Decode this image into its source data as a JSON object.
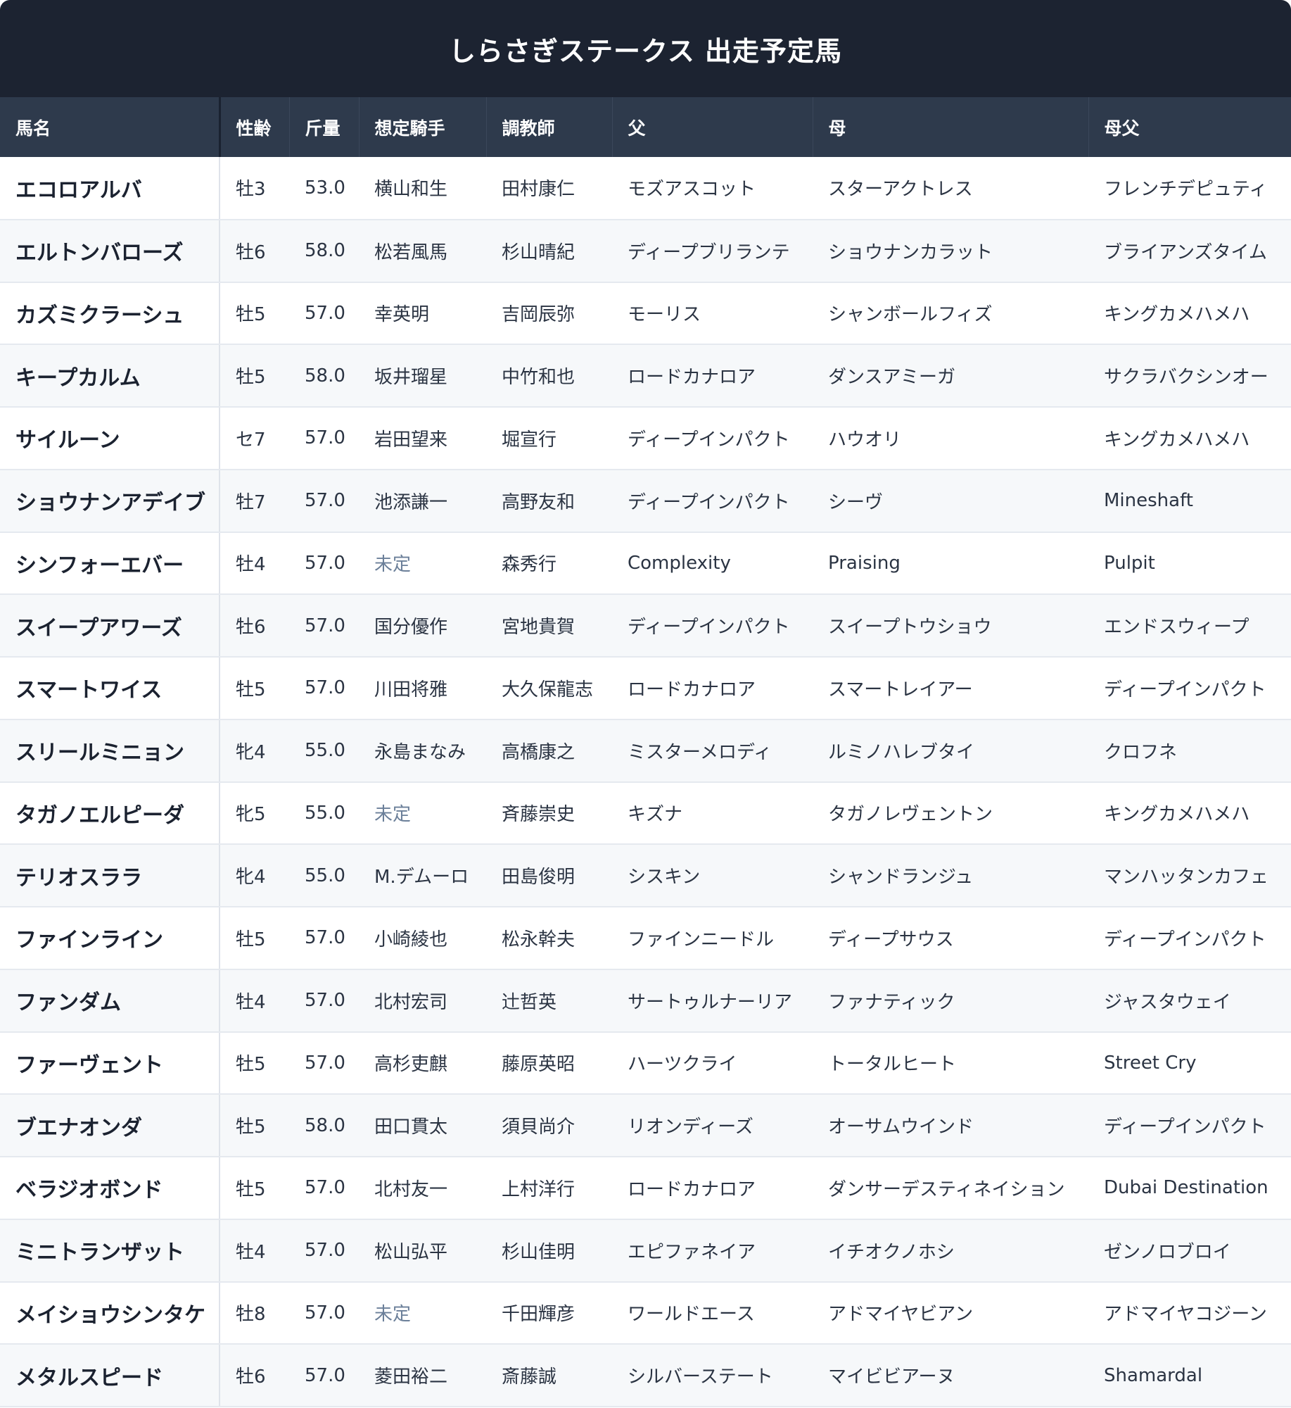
{
  "title": "しらさぎステークス 出走予定馬",
  "headers": [
    "馬名",
    "性齢",
    "斤量",
    "想定騎手",
    "調教師",
    "父",
    "母",
    "母父"
  ],
  "undecided_color": "#6b7f99",
  "rows": [
    {
      "name": "エコロアルバ",
      "sex_age": "牡3",
      "weight": "53.0",
      "jockey": "横山和生",
      "trainer": "田村康仁",
      "sire": "モズアスコット",
      "dam": "スターアクトレス",
      "damsire": "フレンチデピュティ"
    },
    {
      "name": "エルトンバローズ",
      "sex_age": "牡6",
      "weight": "58.0",
      "jockey": "松若風馬",
      "trainer": "杉山晴紀",
      "sire": "ディープブリランテ",
      "dam": "ショウナンカラット",
      "damsire": "ブライアンズタイム"
    },
    {
      "name": "カズミクラーシュ",
      "sex_age": "牡5",
      "weight": "57.0",
      "jockey": "幸英明",
      "trainer": "吉岡辰弥",
      "sire": "モーリス",
      "dam": "シャンボールフィズ",
      "damsire": "キングカメハメハ"
    },
    {
      "name": "キープカルム",
      "sex_age": "牡5",
      "weight": "58.0",
      "jockey": "坂井瑠星",
      "trainer": "中竹和也",
      "sire": "ロードカナロア",
      "dam": "ダンスアミーガ",
      "damsire": "サクラバクシンオー"
    },
    {
      "name": "サイルーン",
      "sex_age": "セ7",
      "weight": "57.0",
      "jockey": "岩田望来",
      "trainer": "堀宣行",
      "sire": "ディープインパクト",
      "dam": "ハウオリ",
      "damsire": "キングカメハメハ"
    },
    {
      "name": "ショウナンアデイブ",
      "sex_age": "牡7",
      "weight": "57.0",
      "jockey": "池添謙一",
      "trainer": "高野友和",
      "sire": "ディープインパクト",
      "dam": "シーヴ",
      "damsire": "Mineshaft"
    },
    {
      "name": "シンフォーエバー",
      "sex_age": "牡4",
      "weight": "57.0",
      "jockey": "未定",
      "jockey_undecided": true,
      "trainer": "森秀行",
      "sire": "Complexity",
      "dam": "Praising",
      "damsire": "Pulpit"
    },
    {
      "name": "スイープアワーズ",
      "sex_age": "牡6",
      "weight": "57.0",
      "jockey": "国分優作",
      "trainer": "宮地貴賀",
      "sire": "ディープインパクト",
      "dam": "スイープトウショウ",
      "damsire": "エンドスウィープ"
    },
    {
      "name": "スマートワイス",
      "sex_age": "牡5",
      "weight": "57.0",
      "jockey": "川田将雅",
      "trainer": "大久保龍志",
      "sire": "ロードカナロア",
      "dam": "スマートレイアー",
      "damsire": "ディープインパクト"
    },
    {
      "name": "スリールミニョン",
      "sex_age": "牝4",
      "weight": "55.0",
      "jockey": "永島まなみ",
      "trainer": "高橋康之",
      "sire": "ミスターメロディ",
      "dam": "ルミノハレブタイ",
      "damsire": "クロフネ"
    },
    {
      "name": "タガノエルピーダ",
      "sex_age": "牝5",
      "weight": "55.0",
      "jockey": "未定",
      "jockey_undecided": true,
      "trainer": "斉藤崇史",
      "sire": "キズナ",
      "dam": "タガノレヴェントン",
      "damsire": "キングカメハメハ"
    },
    {
      "name": "テリオスララ",
      "sex_age": "牝4",
      "weight": "55.0",
      "jockey": "M.デムーロ",
      "trainer": "田島俊明",
      "sire": "シスキン",
      "dam": "シャンドランジュ",
      "damsire": "マンハッタンカフェ"
    },
    {
      "name": "ファインライン",
      "sex_age": "牡5",
      "weight": "57.0",
      "jockey": "小崎綾也",
      "trainer": "松永幹夫",
      "sire": "ファインニードル",
      "dam": "ディープサウス",
      "damsire": "ディープインパクト"
    },
    {
      "name": "ファンダム",
      "sex_age": "牡4",
      "weight": "57.0",
      "jockey": "北村宏司",
      "trainer": "辻哲英",
      "sire": "サートゥルナーリア",
      "dam": "ファナティック",
      "damsire": "ジャスタウェイ"
    },
    {
      "name": "ファーヴェント",
      "sex_age": "牡5",
      "weight": "57.0",
      "jockey": "高杉吏麒",
      "trainer": "藤原英昭",
      "sire": "ハーツクライ",
      "dam": "トータルヒート",
      "damsire": "Street Cry"
    },
    {
      "name": "ブエナオンダ",
      "sex_age": "牡5",
      "weight": "58.0",
      "jockey": "田口貫太",
      "trainer": "須貝尚介",
      "sire": "リオンディーズ",
      "dam": "オーサムウインド",
      "damsire": "ディープインパクト"
    },
    {
      "name": "ベラジオボンド",
      "sex_age": "牡5",
      "weight": "57.0",
      "jockey": "北村友一",
      "trainer": "上村洋行",
      "sire": "ロードカナロア",
      "dam": "ダンサーデスティネイション",
      "damsire": "Dubai Destination"
    },
    {
      "name": "ミニトランザット",
      "sex_age": "牡4",
      "weight": "57.0",
      "jockey": "松山弘平",
      "trainer": "杉山佳明",
      "sire": "エピファネイア",
      "dam": "イチオクノホシ",
      "damsire": "ゼンノロブロイ"
    },
    {
      "name": "メイショウシンタケ",
      "sex_age": "牡8",
      "weight": "57.0",
      "jockey": "未定",
      "jockey_undecided": true,
      "trainer": "千田輝彦",
      "sire": "ワールドエース",
      "dam": "アドマイヤビアン",
      "damsire": "アドマイヤコジーン"
    },
    {
      "name": "メタルスピード",
      "sex_age": "牡6",
      "weight": "57.0",
      "jockey": "菱田裕二",
      "trainer": "斎藤誠",
      "sire": "シルバーステート",
      "dam": "マイビビアーヌ",
      "damsire": "Shamardal"
    }
  ]
}
